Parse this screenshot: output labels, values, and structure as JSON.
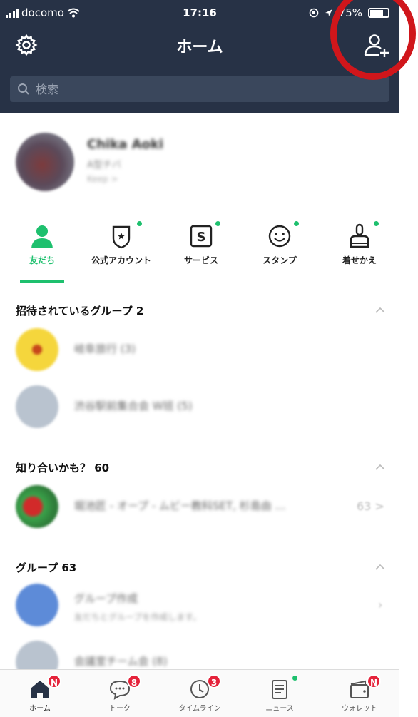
{
  "status": {
    "carrier": "docomo",
    "time": "17:16",
    "battery": "75%"
  },
  "header": {
    "title": "ホーム"
  },
  "search": {
    "placeholder": "検索"
  },
  "profile": {
    "name": "Chika Aoki",
    "status_message": "A型チバ",
    "note": "Keep >"
  },
  "tabs": [
    {
      "label": "友だち",
      "icon": "person-icon",
      "active": true
    },
    {
      "label": "公式アカウント",
      "icon": "official-account-icon"
    },
    {
      "label": "サービス",
      "icon": "service-icon"
    },
    {
      "label": "スタンプ",
      "icon": "sticker-icon"
    },
    {
      "label": "着せかえ",
      "icon": "theme-brush-icon"
    }
  ],
  "sections": {
    "invited": {
      "title": "招待されているグループ 2"
    },
    "suggest": {
      "title": "知り合いかも？ 60"
    },
    "groups": {
      "title": "グループ 63"
    }
  },
  "rows": [
    {
      "title": "岐阜旅行 (3)"
    },
    {
      "title": "渋谷駅前集合会 W班 (5)"
    },
    {
      "title": "堀池匠 - オープ - ムビー教科SET, 杉島由 …",
      "count": "63 >"
    },
    {
      "title": "グループ作成",
      "subtitle": "友だちとグループを作成します。"
    },
    {
      "title": "会議室チーム会 (8)"
    }
  ],
  "bottom_nav": [
    {
      "label": "ホーム",
      "icon": "home-icon",
      "badge": "N"
    },
    {
      "label": "トーク",
      "icon": "chat-icon",
      "badge": "8"
    },
    {
      "label": "タイムライン",
      "icon": "timeline-icon",
      "badge": "3"
    },
    {
      "label": "ニュース",
      "icon": "news-icon"
    },
    {
      "label": "ウォレット",
      "icon": "wallet-icon",
      "badge": "N"
    }
  ],
  "colors": {
    "header_bg": "#273246",
    "accent": "#1ec06e",
    "badge": "#e5233b",
    "highlight_ring": "#d0161b"
  }
}
